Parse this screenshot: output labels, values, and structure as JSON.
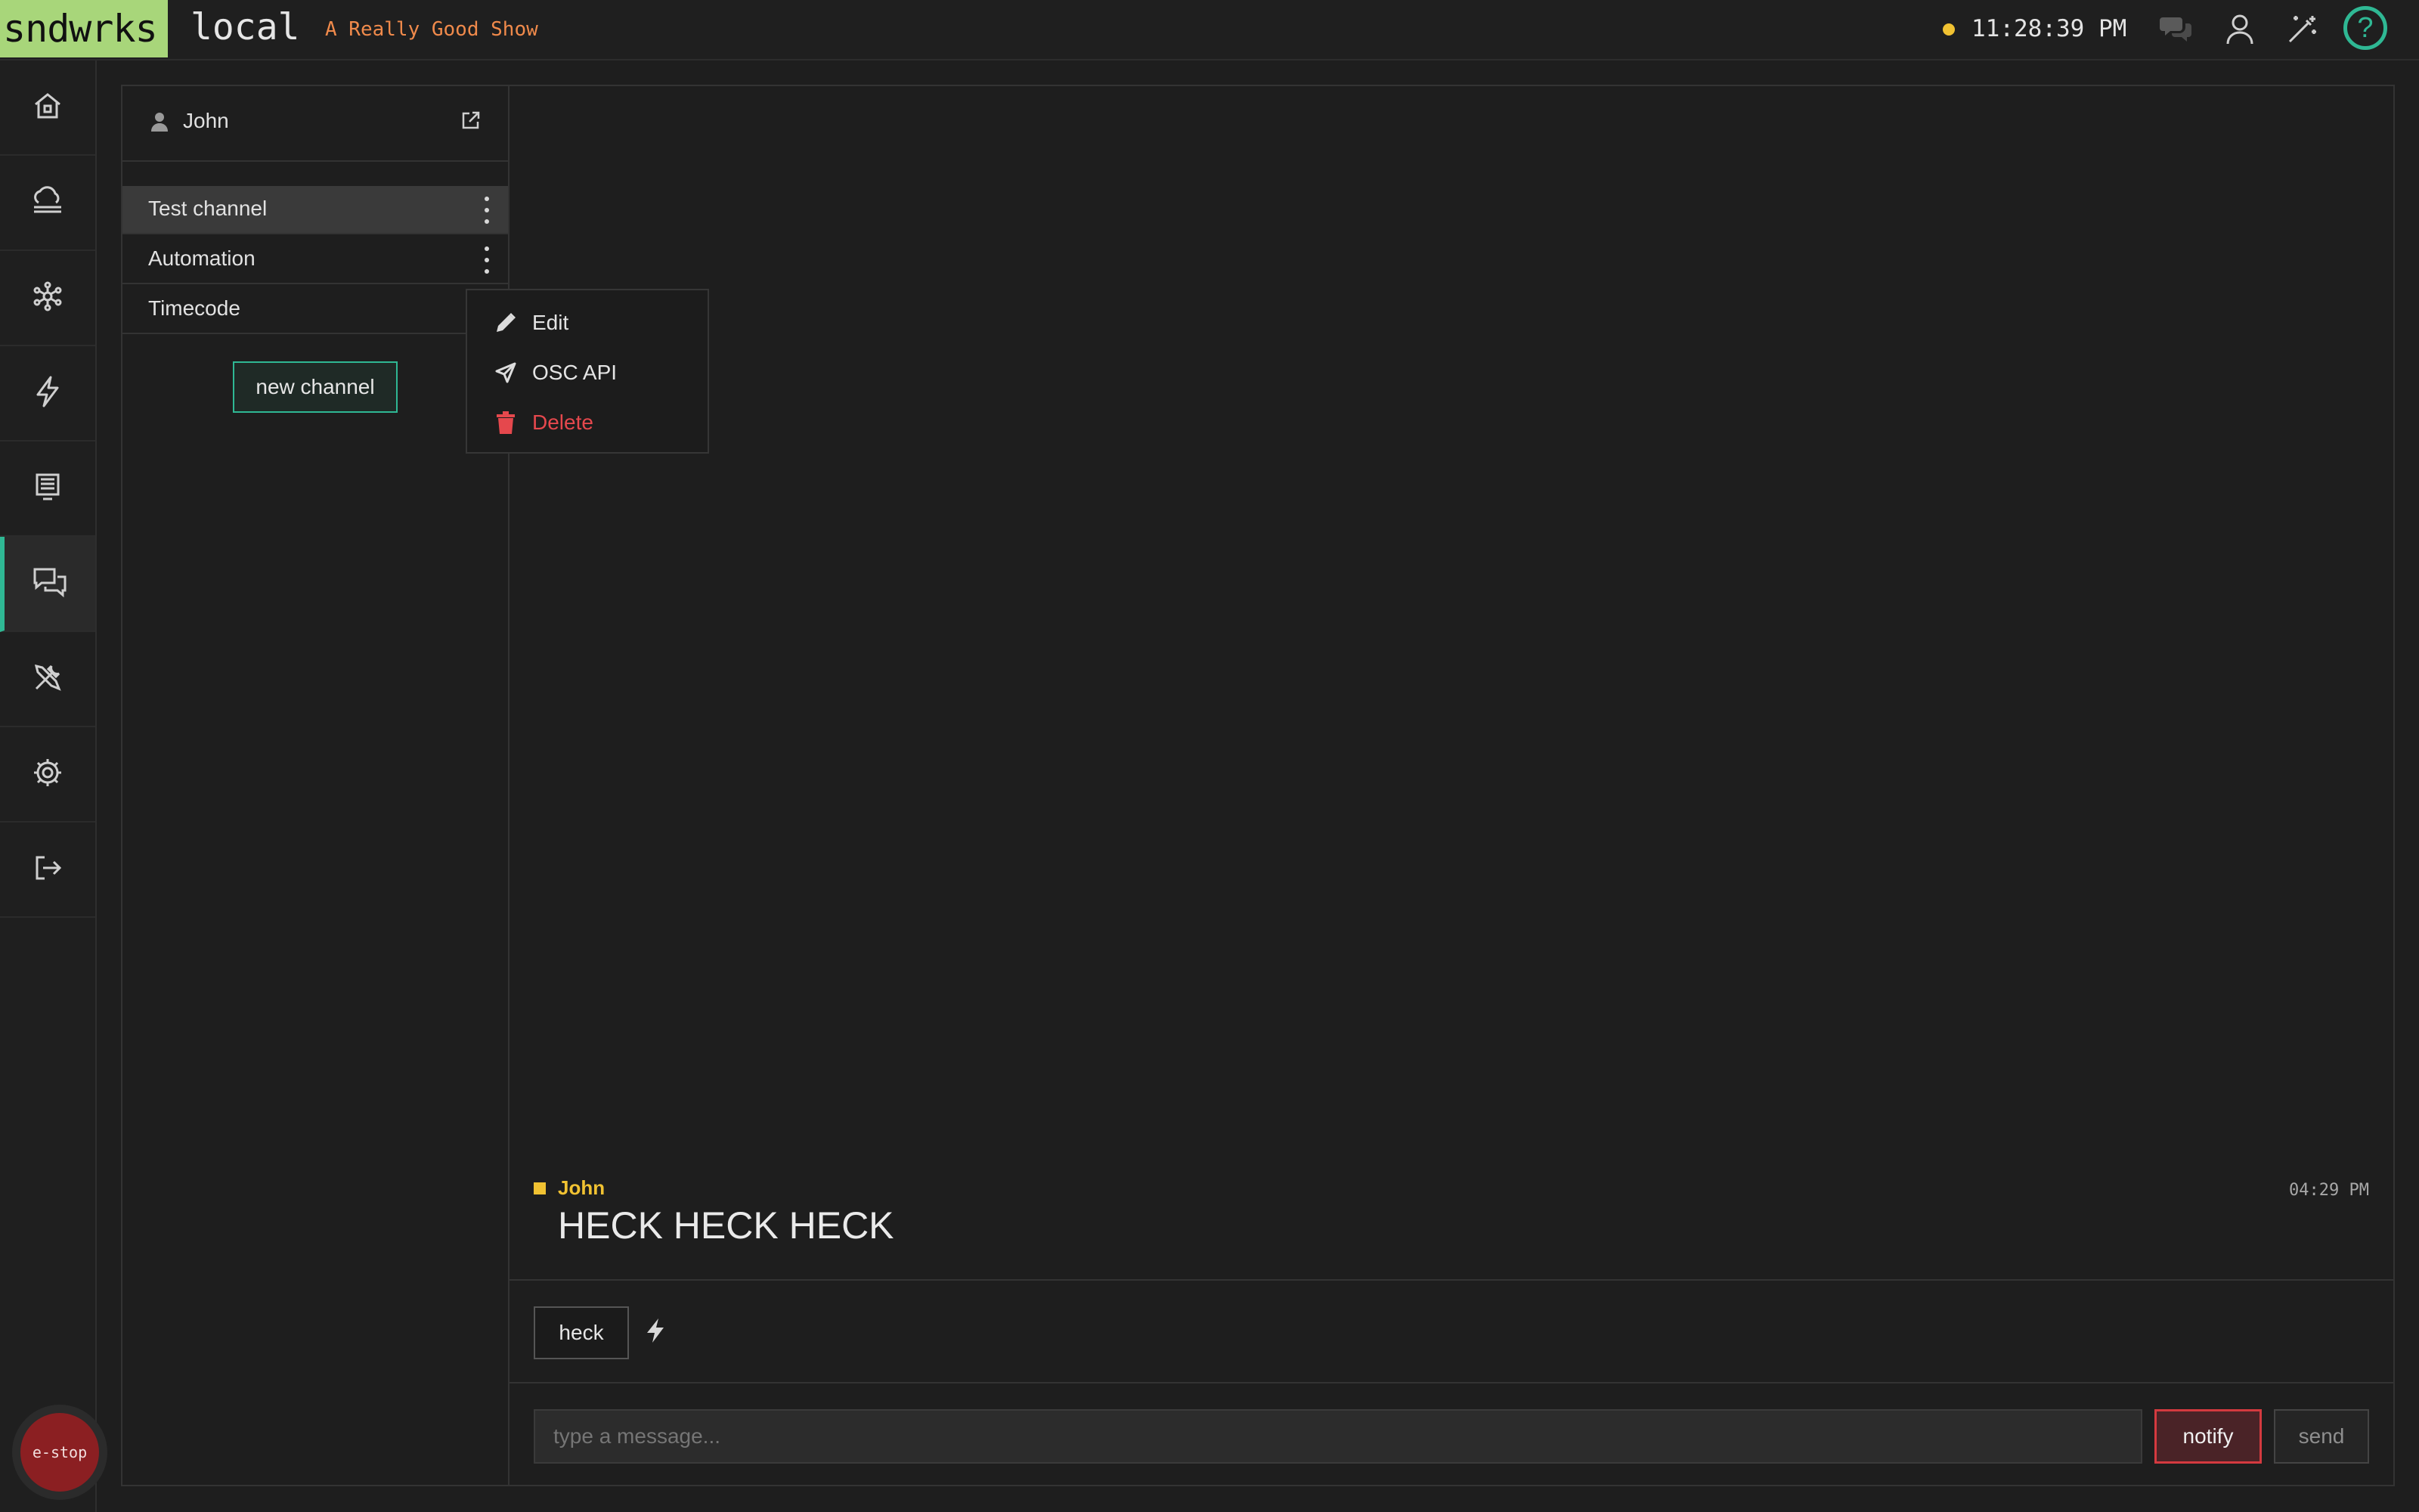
{
  "app": {
    "brand": "sndwrks",
    "environment": "local",
    "show_name": "A Really Good Show",
    "clock": "11:28:39 PM",
    "help_label": "?"
  },
  "colors": {
    "accent": "#2fb894",
    "brand_bg": "#a8d67a",
    "show_name": "#f08a4b",
    "status_dot": "#f1c232",
    "danger": "#e5484d"
  },
  "topbar_icons": [
    "chat-bubbles-icon",
    "user-icon",
    "magic-wand-icon",
    "help-icon"
  ],
  "nav": {
    "items": [
      {
        "name": "home",
        "icon": "home-icon"
      },
      {
        "name": "cloud",
        "icon": "cloud-server-icon"
      },
      {
        "name": "network",
        "icon": "network-nodes-icon"
      },
      {
        "name": "triggers",
        "icon": "lightning-icon"
      },
      {
        "name": "display",
        "icon": "monitor-icon"
      },
      {
        "name": "chat",
        "icon": "chat-icon",
        "active": true
      },
      {
        "name": "tools",
        "icon": "tools-icon"
      },
      {
        "name": "settings",
        "icon": "gear-icon"
      },
      {
        "name": "logout",
        "icon": "logout-icon"
      }
    ],
    "estop_label": "e-stop"
  },
  "channels": {
    "user": "John",
    "list": [
      {
        "label": "Test channel",
        "selected": true
      },
      {
        "label": "Automation",
        "selected": false
      },
      {
        "label": "Timecode",
        "selected": false
      }
    ],
    "new_channel_label": "new channel"
  },
  "context_menu": {
    "items": [
      {
        "label": "Edit",
        "icon": "pencil-icon"
      },
      {
        "label": "OSC API",
        "icon": "send-icon"
      },
      {
        "label": "Delete",
        "icon": "trash-icon",
        "danger": true
      }
    ]
  },
  "messages": [
    {
      "author": "John",
      "time": "04:29 PM",
      "text": "HECK HECK HECK"
    }
  ],
  "quick_messages": {
    "buttons": [
      "heck"
    ]
  },
  "composer": {
    "placeholder": "type a message...",
    "notify_label": "notify",
    "send_label": "send"
  }
}
